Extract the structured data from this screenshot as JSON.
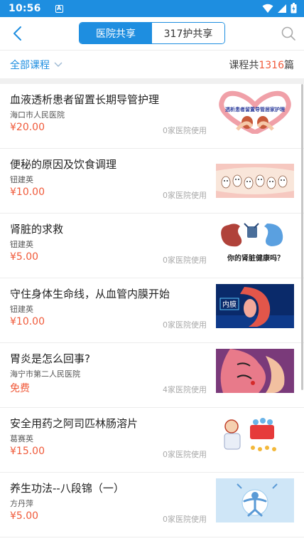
{
  "status_bar": {
    "time": "10:56",
    "notif_letter": "A"
  },
  "header": {
    "tabs": [
      {
        "label": "医院共享",
        "active": true
      },
      {
        "label": "317护共享",
        "active": false
      }
    ]
  },
  "filter": {
    "category_label": "全部课程",
    "count_prefix": "课程共",
    "count_value": "1316",
    "count_suffix": "篇"
  },
  "courses": [
    {
      "title": "血液透析患者留置长期导管护理",
      "author": "海口市人民医院",
      "price": "¥20.00",
      "usage": "0家医院使用",
      "thumb_icon": "dialysis-catheter-illustration",
      "thumb_text": "透析患者留置导管居家护理"
    },
    {
      "title": "便秘的原因及饮食调理",
      "author": "钮建英",
      "price": "¥10.00",
      "usage": "0家医院使用",
      "thumb_icon": "intestine-cartoon-illustration"
    },
    {
      "title": "肾脏的求救",
      "author": "钮建英",
      "price": "¥5.00",
      "usage": "0家医院使用",
      "thumb_icon": "kidney-cartoon-illustration",
      "thumb_text": "你的肾脏健康吗？"
    },
    {
      "title": "守住身体生命线，从血管内膜开始",
      "author": "钮建英",
      "price": "¥10.00",
      "usage": "0家医院使用",
      "thumb_icon": "blood-vessel-illustration",
      "thumb_text": "内膜"
    },
    {
      "title": "胃炎是怎么回事?",
      "author": "海宁市第二人民医院",
      "price": "免费",
      "usage": "4家医院使用",
      "thumb_icon": "stomach-ache-illustration"
    },
    {
      "title": "安全用药之阿司匹林肠溶片",
      "author": "葛赛英",
      "price": "¥15.00",
      "usage": "0家医院使用",
      "thumb_icon": "doctor-medicine-illustration"
    },
    {
      "title": "养生功法--八段锦（一）",
      "author": "方丹萍",
      "price": "¥5.00",
      "usage": "0家医院使用",
      "thumb_icon": "qigong-figure-illustration"
    }
  ],
  "colors": {
    "brand": "#1e8ee0",
    "price": "#f05a3a"
  }
}
